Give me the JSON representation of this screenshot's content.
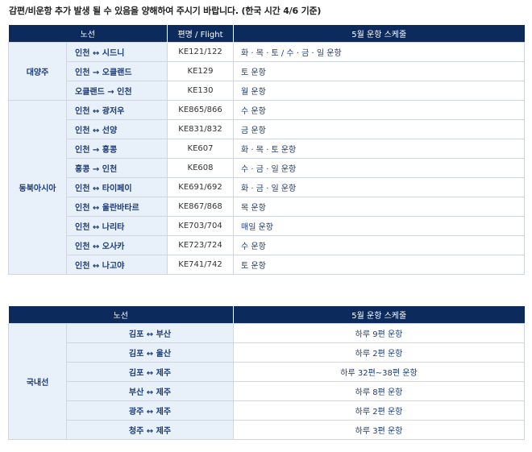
{
  "notice": "감편/비운항 추가 발생 될 수 있음을 양해하여 주시기 바랍니다. (한국 시간 4/6 기준)",
  "international": {
    "headers": {
      "route": "노선",
      "flight": "편명 / Flight",
      "schedule": "5월 운항 스케줄"
    },
    "groups": [
      {
        "region": "대양주",
        "rows": [
          {
            "route": "인천 ↔ 시드니",
            "flight": "KE121/122",
            "schedule": "화 · 목 · 토 / 수 · 금 · 일 운항"
          },
          {
            "route": "인천 → 오클랜드",
            "flight": "KE129",
            "schedule": "토 운항"
          },
          {
            "route": "오클랜드 → 인천",
            "flight": "KE130",
            "schedule": "월 운항"
          }
        ]
      },
      {
        "region": "동북아시아",
        "rows": [
          {
            "route": "인천 ↔ 광저우",
            "flight": "KE865/866",
            "schedule": "수 운항"
          },
          {
            "route": "인천 ↔ 선양",
            "flight": "KE831/832",
            "schedule": "금 운항"
          },
          {
            "route": "인천 → 홍콩",
            "flight": "KE607",
            "schedule": "화 · 목 · 토 운항"
          },
          {
            "route": "홍콩 → 인천",
            "flight": "KE608",
            "schedule": "수 · 금 · 일 운항"
          },
          {
            "route": "인천 ↔ 타이페이",
            "flight": "KE691/692",
            "schedule": "화 · 금 · 일 운항"
          },
          {
            "route": "인천 ↔ 울란바타르",
            "flight": "KE867/868",
            "schedule": "목 운항"
          },
          {
            "route": "인천 ↔ 나리타",
            "flight": "KE703/704",
            "schedule": "매일 운항"
          },
          {
            "route": "인천 ↔ 오사카",
            "flight": "KE723/724",
            "schedule": "수 운항"
          },
          {
            "route": "인천 ↔ 나고야",
            "flight": "KE741/742",
            "schedule": "토 운항"
          }
        ]
      }
    ]
  },
  "domestic": {
    "headers": {
      "route": "노선",
      "schedule": "5월 운항 스케줄"
    },
    "region": "국내선",
    "rows": [
      {
        "route": "김포 ↔ 부산",
        "schedule": "하루 9편 운항"
      },
      {
        "route": "김포 ↔ 울산",
        "schedule": "하루 2편 운항"
      },
      {
        "route": "김포 ↔ 제주",
        "schedule": "하루 32편~38편 운항"
      },
      {
        "route": "부산 ↔ 제주",
        "schedule": "하루 8편 운항"
      },
      {
        "route": "광주 ↔ 제주",
        "schedule": "하루 2편 운항"
      },
      {
        "route": "청주 ↔ 제주",
        "schedule": "하루 3편 운항"
      }
    ]
  }
}
